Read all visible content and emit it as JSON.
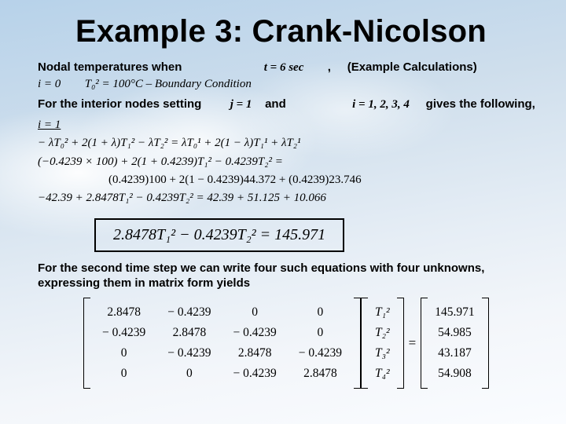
{
  "title": "Example 3: Crank-Nicolson",
  "line1": {
    "a": "Nodal temperatures when",
    "t_eq": "t = 6 sec",
    "comma": ",",
    "b": "(Example Calculations)"
  },
  "bc": {
    "i0": "i = 0",
    "expr": "T₀² = 100°C – Boundary Condition"
  },
  "line2": {
    "a": "For the interior nodes setting",
    "j_eq": "j = 1",
    "and": "and",
    "i_eq": "i = 1, 2, 3, 4",
    "b": "gives the following,"
  },
  "derive": {
    "i1": "i = 1",
    "r1": "− λT₀² + 2(1 + λ)T₁² − λT₂² = λT₀¹ + 2(1 − λ)T₁¹ + λT₂¹",
    "r2": "(−0.4239 × 100) + 2(1 + 0.4239)T₁² − 0.4239T₂² =",
    "r3": "(0.4239)100 + 2(1 − 0.4239)44.372 + (0.4239)23.746",
    "r4": "−42.39 + 2.8478T₁² − 0.4239T₂² = 42.39 + 51.125 + 10.066"
  },
  "boxed": "2.8478T₁² − 0.4239T₂² = 145.971",
  "para": "For the second time step we can write four such equations with four unknowns, expressing them in matrix form yields",
  "matrix": {
    "A": [
      [
        "2.8478",
        "− 0.4239",
        "0",
        "0"
      ],
      [
        "− 0.4239",
        "2.8478",
        "− 0.4239",
        "0"
      ],
      [
        "0",
        "− 0.4239",
        "2.8478",
        "− 0.4239"
      ],
      [
        "0",
        "0",
        "− 0.4239",
        "2.8478"
      ]
    ],
    "x": [
      "T₁²",
      "T₂²",
      "T₃²",
      "T₄²"
    ],
    "b": [
      "145.971",
      "54.985",
      "43.187",
      "54.908"
    ]
  }
}
